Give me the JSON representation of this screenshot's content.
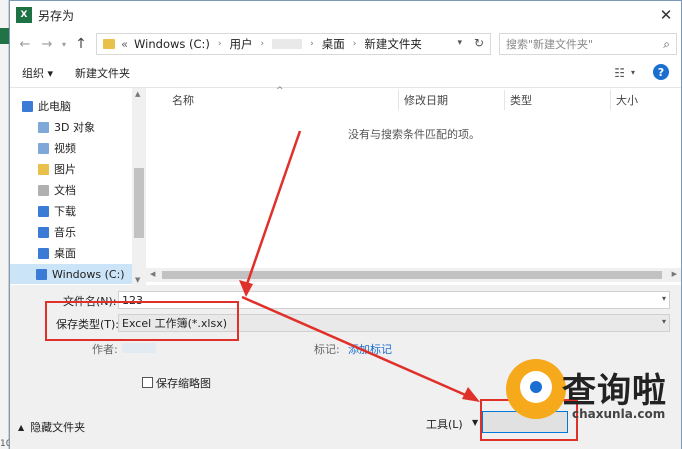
{
  "window": {
    "title": "另存为",
    "app_icon": "X"
  },
  "address": {
    "crumbs": [
      "Windows (C:)",
      "用户",
      "桌面",
      "新建文件夹"
    ],
    "prefix": "«",
    "search_placeholder": "搜索\"新建文件夹\""
  },
  "toolbar": {
    "organize": "组织 ▾",
    "new_folder": "新建文件夹"
  },
  "nav": {
    "items": [
      {
        "label": "此电脑",
        "icon": "computer-icon",
        "color": "#3a7bd5"
      },
      {
        "label": "3D 对象",
        "icon": "cube-icon",
        "color": "#7fa7d8"
      },
      {
        "label": "视频",
        "icon": "video-icon",
        "color": "#7fa7d8"
      },
      {
        "label": "图片",
        "icon": "pictures-icon",
        "color": "#e9c04a"
      },
      {
        "label": "文档",
        "icon": "documents-icon",
        "color": "#b0b0b0"
      },
      {
        "label": "下载",
        "icon": "download-icon",
        "color": "#3a7bd5"
      },
      {
        "label": "音乐",
        "icon": "music-icon",
        "color": "#3a7bd5"
      },
      {
        "label": "桌面",
        "icon": "desktop-icon",
        "color": "#3a7bd5"
      },
      {
        "label": "Windows (C:)",
        "icon": "drive-icon",
        "color": "#3a7bd5"
      }
    ]
  },
  "columns": [
    "名称",
    "修改日期",
    "类型",
    "大小"
  ],
  "empty_message": "没有与搜索条件匹配的项。",
  "form": {
    "filename_label": "文件名(N):",
    "filename_value": "123",
    "savetype_label": "保存类型(T):",
    "savetype_value": "Excel 工作簿(*.xlsx)",
    "author_label": "作者:",
    "tags_label": "标记:",
    "tags_link": "添加标记",
    "thumbnail_label": "保存缩略图"
  },
  "bottom": {
    "hide_folders": "隐藏文件夹",
    "tools": "工具(L)"
  },
  "background": {
    "row_number": "10"
  },
  "watermark": {
    "brand": "查询啦",
    "site": "chaxunla.com"
  },
  "annotation_color": "#e0302a"
}
